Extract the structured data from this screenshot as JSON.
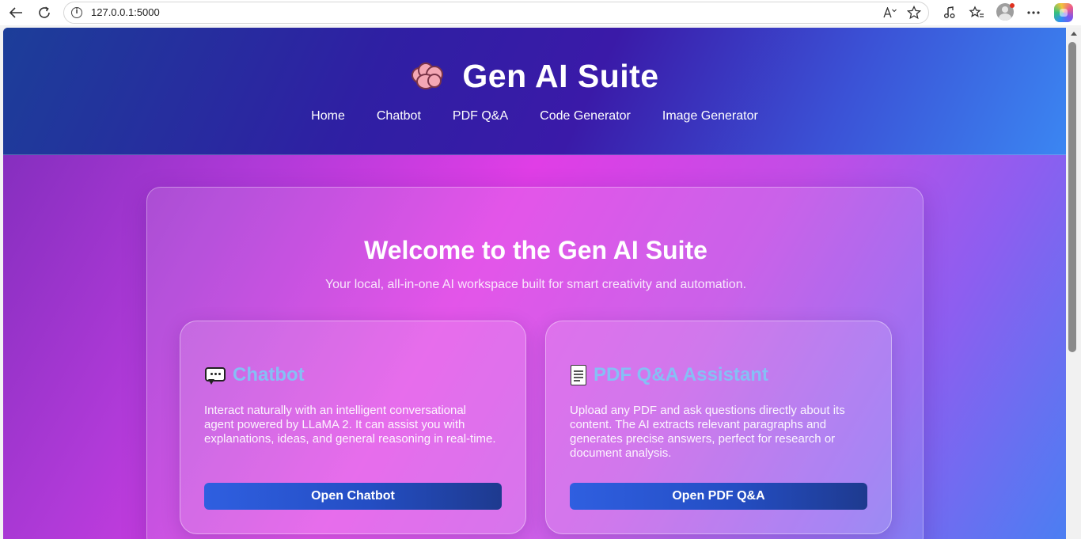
{
  "browser": {
    "url": "127.0.0.1:5000",
    "icons": [
      "back-arrow-icon",
      "refresh-icon",
      "info-icon",
      "read-aloud-icon",
      "favorite-star-icon",
      "extensions-icon",
      "favorites-icon",
      "profile-avatar",
      "more-menu-icon",
      "copilot-icon"
    ]
  },
  "header": {
    "title": "Gen AI Suite",
    "icon": "brain-icon",
    "nav": [
      "Home",
      "Chatbot",
      "PDF Q&A",
      "Code Generator",
      "Image Generator"
    ]
  },
  "welcome": {
    "title": "Welcome to the Gen AI Suite",
    "subtitle": "Your local, all-in-one AI workspace built for smart creativity and automation."
  },
  "cards": [
    {
      "icon": "speech-bubble-icon",
      "title": "Chatbot",
      "description": "Interact naturally with an intelligent conversational agent powered by LLaMA 2. It can assist you with explanations, ideas, and general reasoning in real-time.",
      "button": "Open Chatbot"
    },
    {
      "icon": "document-icon",
      "title": "PDF Q&A Assistant",
      "description": "Upload any PDF and ask questions directly about its content. The AI extracts relevant paragraphs and generates precise answers, perfect for research or document analysis.",
      "button": "Open PDF Q&A"
    }
  ],
  "colors": {
    "header_start": "#1c3e99",
    "header_end": "#3b86f2",
    "accent_magenta": "#e03ee6",
    "card_title": "#86bff5",
    "button": "#244ec4"
  }
}
